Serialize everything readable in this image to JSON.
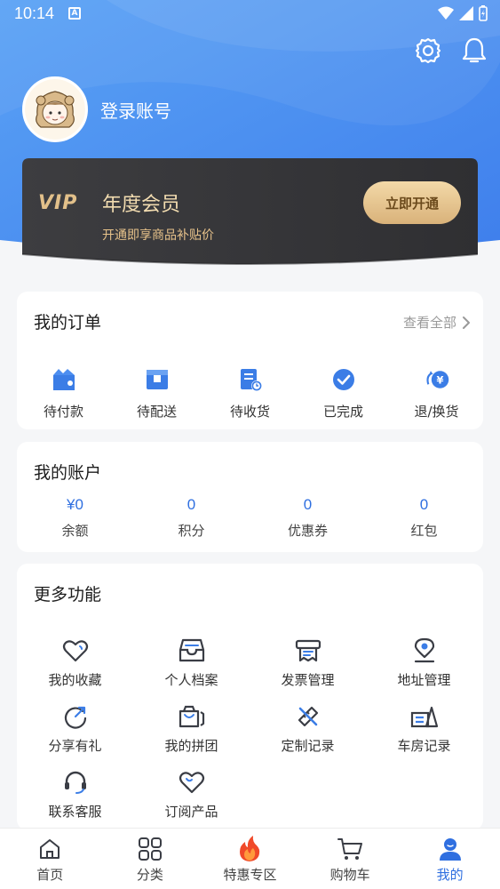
{
  "status_bar": {
    "time": "10:14"
  },
  "profile": {
    "login_label": "登录账号"
  },
  "vip": {
    "logo_text": "VIP",
    "title": "年度会员",
    "subtitle": "开通即享商品补贴价",
    "button_label": "立即开通"
  },
  "orders": {
    "title": "我的订单",
    "view_all": "查看全部",
    "items": [
      {
        "label": "待付款",
        "icon": "wallet-icon"
      },
      {
        "label": "待配送",
        "icon": "package-icon"
      },
      {
        "label": "待收货",
        "icon": "receipt-clock-icon"
      },
      {
        "label": "已完成",
        "icon": "check-circle-icon"
      },
      {
        "label": "退/换货",
        "icon": "refund-icon"
      }
    ]
  },
  "account": {
    "title": "我的账户",
    "items": [
      {
        "value": "¥0",
        "label": "余额"
      },
      {
        "value": "0",
        "label": "积分"
      },
      {
        "value": "0",
        "label": "优惠券"
      },
      {
        "value": "0",
        "label": "红包"
      }
    ]
  },
  "more": {
    "title": "更多功能",
    "items": [
      {
        "label": "我的收藏",
        "icon": "heart-icon"
      },
      {
        "label": "个人档案",
        "icon": "archive-box-icon"
      },
      {
        "label": "发票管理",
        "icon": "invoice-icon"
      },
      {
        "label": "地址管理",
        "icon": "location-pin-icon"
      },
      {
        "label": "分享有礼",
        "icon": "share-arrow-icon"
      },
      {
        "label": "我的拼团",
        "icon": "group-bag-icon"
      },
      {
        "label": "定制记录",
        "icon": "ruler-pencil-icon"
      },
      {
        "label": "车房记录",
        "icon": "car-house-icon"
      },
      {
        "label": "联系客服",
        "icon": "headset-icon"
      },
      {
        "label": "订阅产品",
        "icon": "subscribe-heart-icon"
      }
    ]
  },
  "tabbar": {
    "items": [
      {
        "label": "首页",
        "icon": "home-icon"
      },
      {
        "label": "分类",
        "icon": "grid-icon"
      },
      {
        "label": "特惠专区",
        "icon": "fire-icon"
      },
      {
        "label": "购物车",
        "icon": "cart-icon"
      },
      {
        "label": "我的",
        "icon": "user-icon",
        "active": true
      }
    ]
  },
  "colors": {
    "primary": "#2f6fe0",
    "header_blue": "#4a8df0",
    "vip_gold": "#e2c08a",
    "vip_card": "#3a3a3c"
  }
}
